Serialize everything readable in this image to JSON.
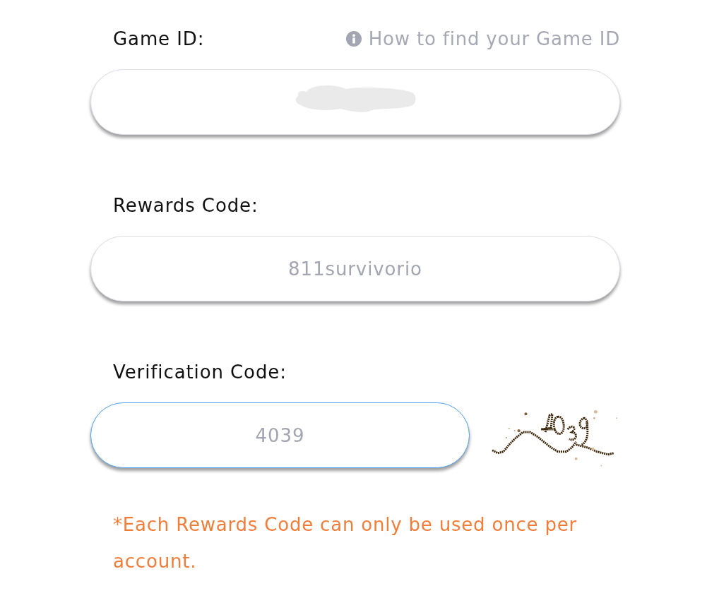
{
  "fields": [
    {
      "kind": "text",
      "label": "Game ID:",
      "help_link": {
        "text": "How to find your Game ID"
      },
      "redacted": true,
      "focused": false
    },
    {
      "kind": "text",
      "label": "Rewards Code:",
      "value": "811survivorio",
      "focused": false
    },
    {
      "kind": "captcha",
      "label": "Verification Code:",
      "value": "4039",
      "focused": true
    }
  ],
  "note": "*Each Rewards Code can only be used once per account."
}
